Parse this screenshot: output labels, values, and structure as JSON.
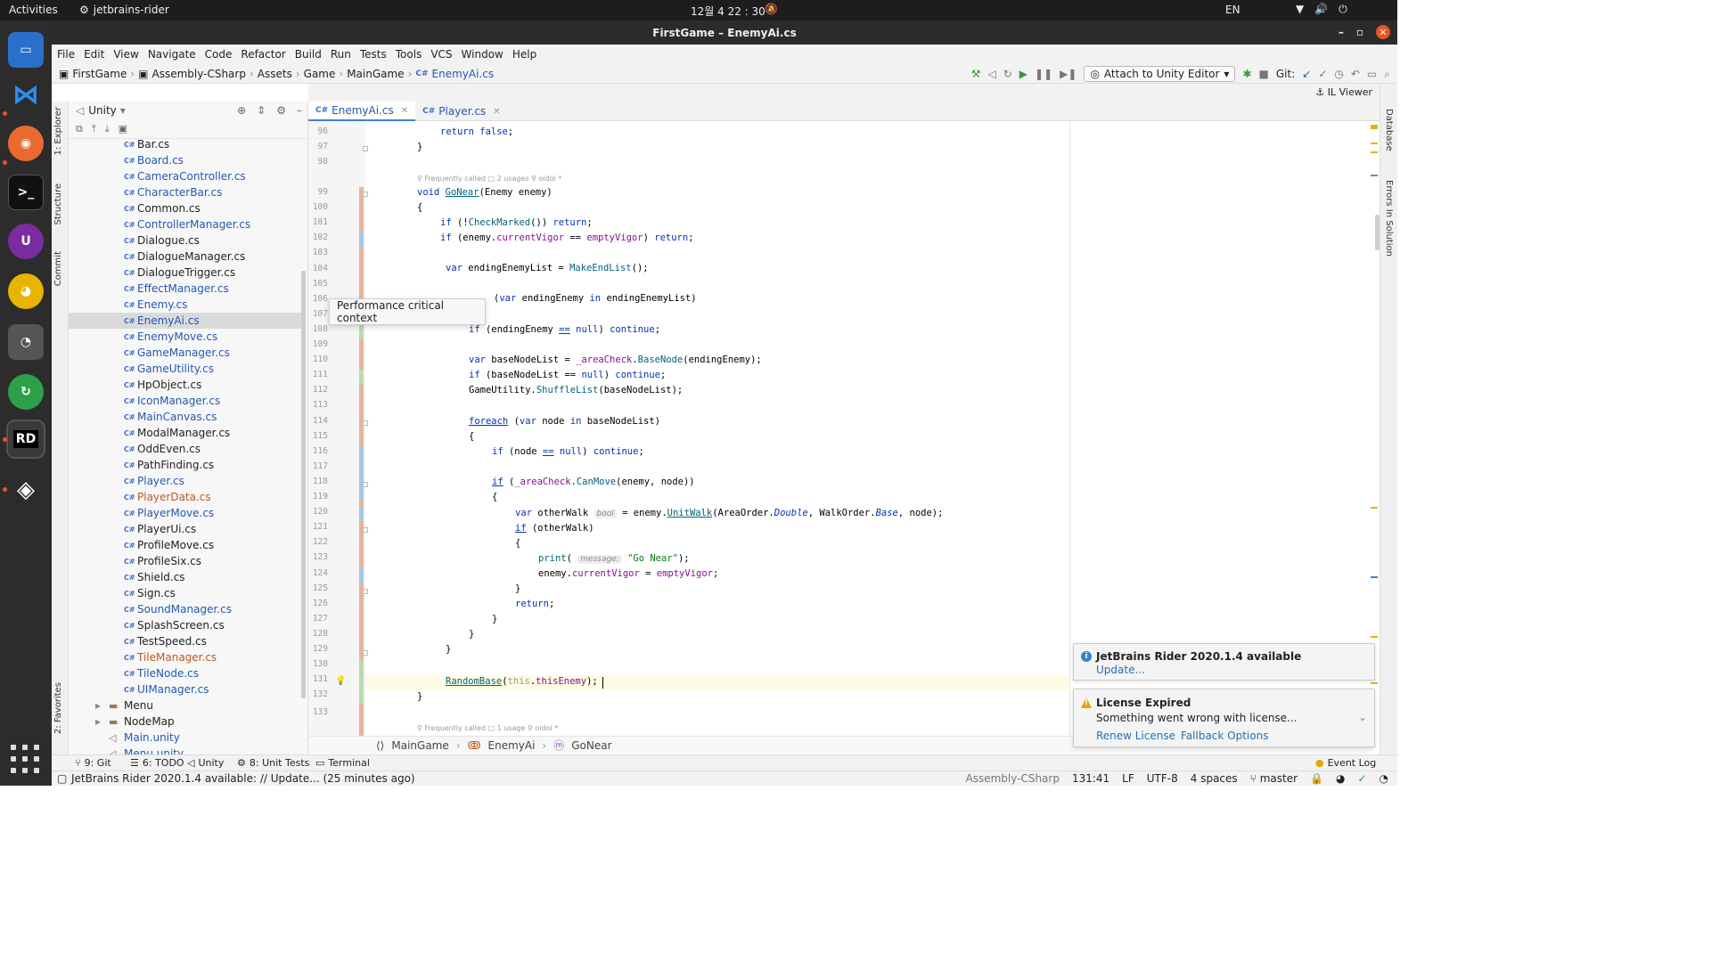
{
  "topbar": {
    "activities": "Activities",
    "app": "jetbrains-rider",
    "clock": "12월 4  22 : 30",
    "lang": "EN"
  },
  "window": {
    "title": "FirstGame – EnemyAi.cs"
  },
  "menu": [
    "File",
    "Edit",
    "View",
    "Navigate",
    "Code",
    "Refactor",
    "Build",
    "Run",
    "Tests",
    "Tools",
    "VCS",
    "Window",
    "Help"
  ],
  "breadcrumb": [
    "FirstGame",
    "Assembly-CSharp",
    "Assets",
    "Game",
    "MainGame",
    "EnemyAi.cs"
  ],
  "toolbar": {
    "attach": "Attach to Unity Editor",
    "git": "Git:"
  },
  "il_viewer": "IL Viewer",
  "explorer": {
    "title": "Unity",
    "files": [
      {
        "name": "Bar.cs",
        "color": "#222222"
      },
      {
        "name": "Board.cs",
        "color": "#2457b3"
      },
      {
        "name": "CameraController.cs",
        "color": "#2457b3"
      },
      {
        "name": "CharacterBar.cs",
        "color": "#2457b3"
      },
      {
        "name": "Common.cs",
        "color": "#222222"
      },
      {
        "name": "ControllerManager.cs",
        "color": "#2457b3"
      },
      {
        "name": "Dialogue.cs",
        "color": "#222222"
      },
      {
        "name": "DialogueManager.cs",
        "color": "#222222"
      },
      {
        "name": "DialogueTrigger.cs",
        "color": "#222222"
      },
      {
        "name": "EffectManager.cs",
        "color": "#2457b3"
      },
      {
        "name": "Enemy.cs",
        "color": "#2457b3"
      },
      {
        "name": "EnemyAi.cs",
        "color": "#2457b3",
        "selected": true
      },
      {
        "name": "EnemyMove.cs",
        "color": "#2457b3"
      },
      {
        "name": "GameManager.cs",
        "color": "#2457b3"
      },
      {
        "name": "GameUtility.cs",
        "color": "#2457b3"
      },
      {
        "name": "HpObject.cs",
        "color": "#222222"
      },
      {
        "name": "IconManager.cs",
        "color": "#2457b3"
      },
      {
        "name": "MainCanvas.cs",
        "color": "#2457b3"
      },
      {
        "name": "ModalManager.cs",
        "color": "#222222"
      },
      {
        "name": "OddEven.cs",
        "color": "#222222"
      },
      {
        "name": "PathFinding.cs",
        "color": "#222222"
      },
      {
        "name": "Player.cs",
        "color": "#2457b3"
      },
      {
        "name": "PlayerData.cs",
        "color": "#c0581c"
      },
      {
        "name": "PlayerMove.cs",
        "color": "#2457b3"
      },
      {
        "name": "PlayerUi.cs",
        "color": "#222222"
      },
      {
        "name": "ProfileMove.cs",
        "color": "#222222"
      },
      {
        "name": "ProfileSix.cs",
        "color": "#222222"
      },
      {
        "name": "Shield.cs",
        "color": "#222222"
      },
      {
        "name": "Sign.cs",
        "color": "#222222"
      },
      {
        "name": "SoundManager.cs",
        "color": "#2457b3"
      },
      {
        "name": "SplashScreen.cs",
        "color": "#222222"
      },
      {
        "name": "TestSpeed.cs",
        "color": "#222222"
      },
      {
        "name": "TileManager.cs",
        "color": "#c0581c"
      },
      {
        "name": "TileNode.cs",
        "color": "#2457b3"
      },
      {
        "name": "UIManager.cs",
        "color": "#2457b3"
      }
    ],
    "folders": [
      "Menu",
      "NodeMap"
    ],
    "scenes": [
      "Main.unity",
      "Menu.unity"
    ]
  },
  "left_tabs": [
    "1: Explorer",
    "Structure",
    "Commit",
    "2: Favorites"
  ],
  "right_tabs": [
    "Database",
    "Errors In Solution"
  ],
  "tabs": [
    {
      "label": "EnemyAi.cs",
      "active": true
    },
    {
      "label": "Player.cs",
      "active": false
    }
  ],
  "code": {
    "line_numbers": [
      "96",
      "97",
      "98",
      "99",
      "100",
      "101",
      "102",
      "103",
      "104",
      "105",
      "106",
      "107",
      "108",
      "109",
      "110",
      "111",
      "112",
      "113",
      "114",
      "115",
      "116",
      "117",
      "118",
      "119",
      "120",
      "121",
      "122",
      "123",
      "124",
      "125",
      "126",
      "127",
      "128",
      "129",
      "130",
      "131",
      "132",
      "133"
    ],
    "lens1": {
      "called": "Frequently called",
      "usages": "2 usages",
      "author": "oidoi *"
    },
    "lens2": {
      "called": "Frequently called",
      "usages": "1 usage",
      "author": "oidoi *"
    },
    "hint_bool": "bool",
    "hint_message": "message:"
  },
  "tooltip": "Performance critical context",
  "editor_breadcrumb": [
    "MainGame",
    "EnemyAi",
    "GoNear"
  ],
  "notifications": [
    {
      "title": "JetBrains Rider 2020.1.4 available",
      "link": "Update..."
    },
    {
      "title": "License Expired",
      "body": "Something went wrong with license...",
      "links": [
        "Renew License",
        "Fallback Options"
      ]
    }
  ],
  "toolwindows": [
    "9: Git",
    "6: TODO",
    "Unity",
    "8: Unit Tests",
    "Terminal"
  ],
  "event_log": "Event Log",
  "status": {
    "message": "JetBrains Rider 2020.1.4 available: // Update... (25 minutes ago)",
    "assembly": "Assembly-CSharp",
    "position": "131:41",
    "line_sep": "LF",
    "encoding": "UTF-8",
    "indent": "4 spaces",
    "branch": "master"
  }
}
